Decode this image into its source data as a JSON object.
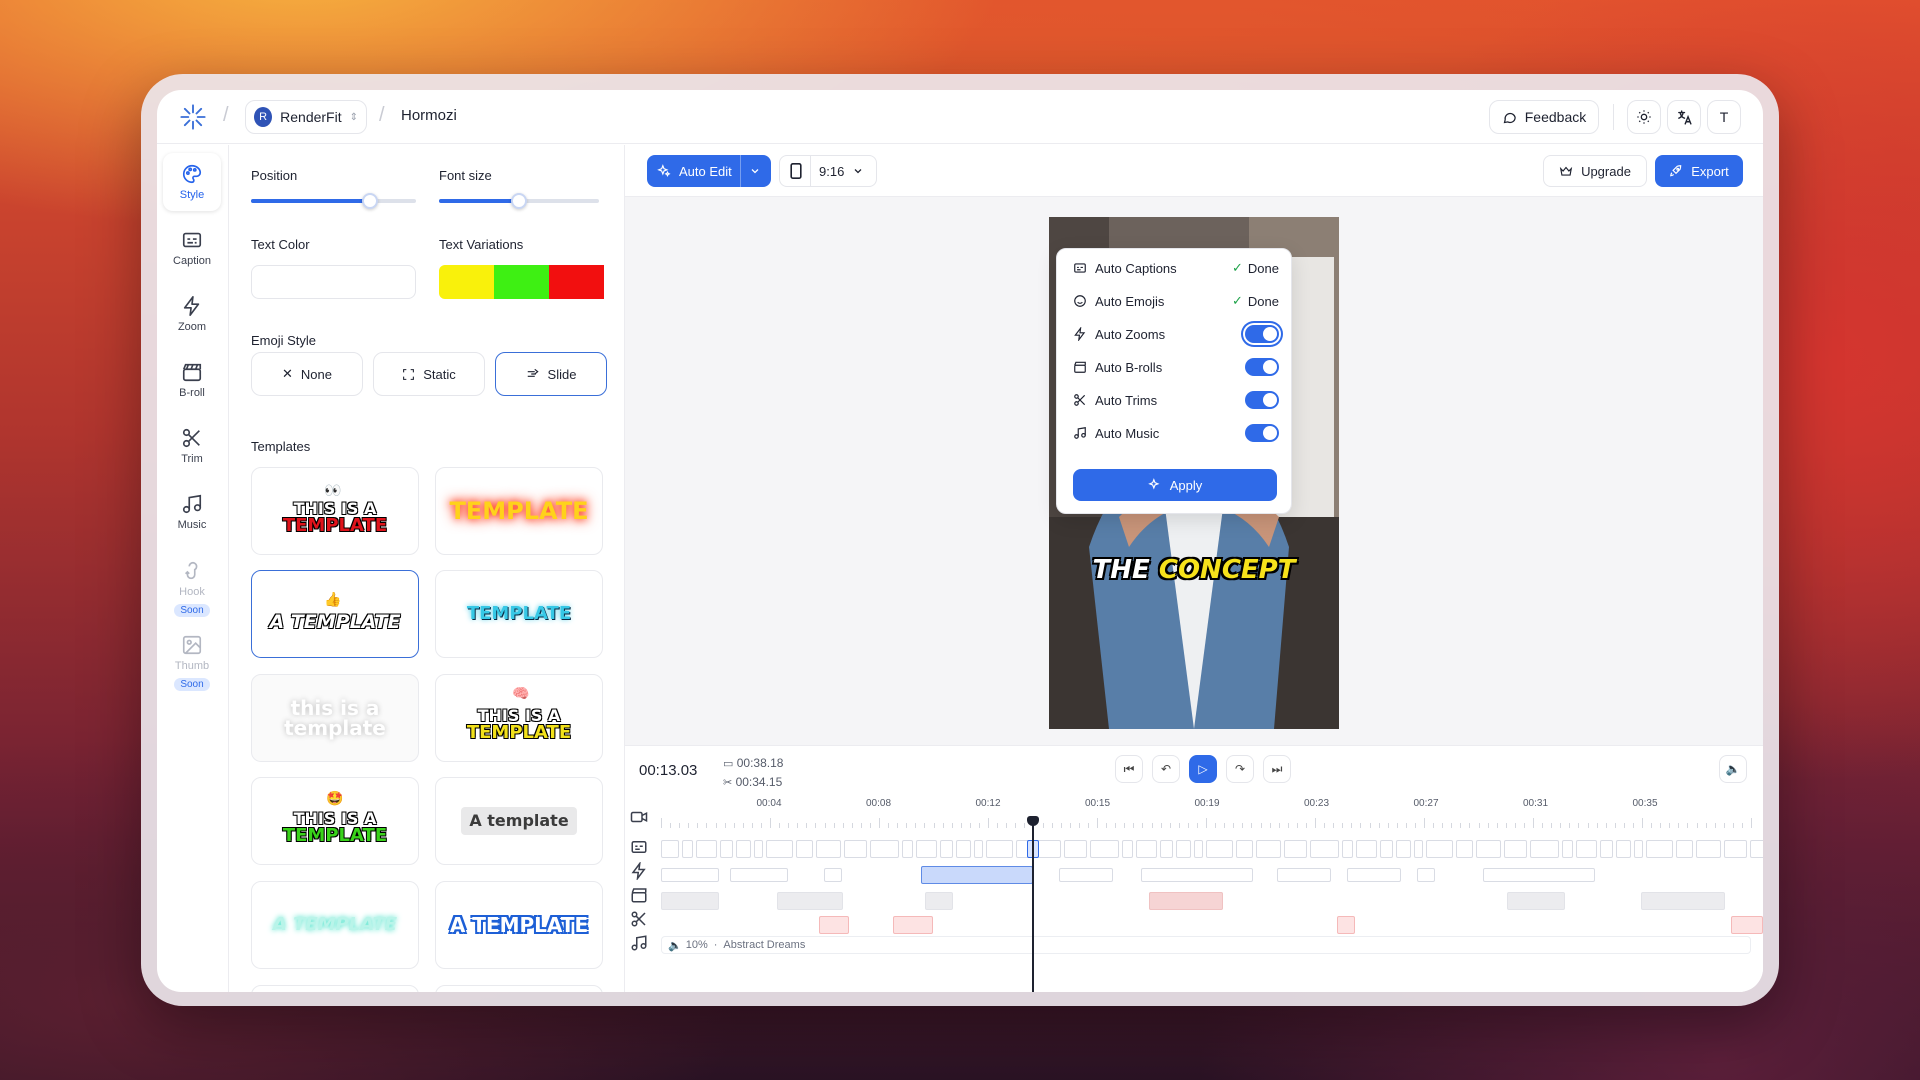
{
  "app": {
    "workspace": "RenderFit",
    "workspace_initial": "R",
    "project": "Hormozi",
    "feedback": "Feedback",
    "user_initial": "T"
  },
  "sidebar": {
    "items": [
      {
        "label": "Style"
      },
      {
        "label": "Caption"
      },
      {
        "label": "Zoom"
      },
      {
        "label": "B-roll"
      },
      {
        "label": "Trim"
      },
      {
        "label": "Music"
      },
      {
        "label": "Hook",
        "badge": "Soon"
      },
      {
        "label": "Thumb",
        "badge": "Soon"
      }
    ]
  },
  "style_panel": {
    "position_label": "Position",
    "position_value": 0.72,
    "font_size_label": "Font size",
    "font_size_value": 0.5,
    "text_color_label": "Text Color",
    "text_variations_label": "Text Variations",
    "variation_colors": [
      "#f9f10b",
      "#3ef013",
      "#f20f0f"
    ],
    "emoji_style_label": "Emoji Style",
    "emoji_options": [
      "None",
      "Static",
      "Slide"
    ],
    "emoji_selected": "Slide",
    "templates_label": "Templates",
    "templates": [
      {
        "line1": "THIS IS A",
        "line2": "TEMPLATE"
      },
      {
        "line1": "TEMPLATE"
      },
      {
        "line1": "A TEMPLATE"
      },
      {
        "line1": "TEMPLATE"
      },
      {
        "line1": "this is a",
        "line2": "template"
      },
      {
        "line1": "THIS IS A",
        "line2": "TEMPLATE"
      },
      {
        "line1": "THIS IS A",
        "line2": "TEMPLATE"
      },
      {
        "line1": "A template"
      },
      {
        "line1": "A TEMPLATE"
      },
      {
        "line1": "A TEMPLATE"
      }
    ]
  },
  "toolbar": {
    "auto_edit": "Auto Edit",
    "aspect_ratio": "9:16",
    "upgrade": "Upgrade",
    "export": "Export"
  },
  "auto_edit_menu": {
    "items": [
      {
        "label": "Auto Captions",
        "status": "Done"
      },
      {
        "label": "Auto Emojis",
        "status": "Done"
      },
      {
        "label": "Auto Zooms",
        "enabled": true
      },
      {
        "label": "Auto B-rolls",
        "enabled": true
      },
      {
        "label": "Auto Trims",
        "enabled": true
      },
      {
        "label": "Auto Music",
        "enabled": true
      }
    ],
    "apply": "Apply"
  },
  "preview": {
    "caption_word1": "THE",
    "caption_word2": "CONCEPT"
  },
  "timeline": {
    "current_time": "00:13.03",
    "total_duration": "00:38.18",
    "trimmed_duration": "00:34.15",
    "ticks": [
      "00:04",
      "00:08",
      "00:12",
      "00:15",
      "00:19",
      "00:23",
      "00:27",
      "00:31",
      "00:35"
    ],
    "music_volume": "10%",
    "music_separator": "·",
    "music_track": "Abstract Dreams"
  }
}
